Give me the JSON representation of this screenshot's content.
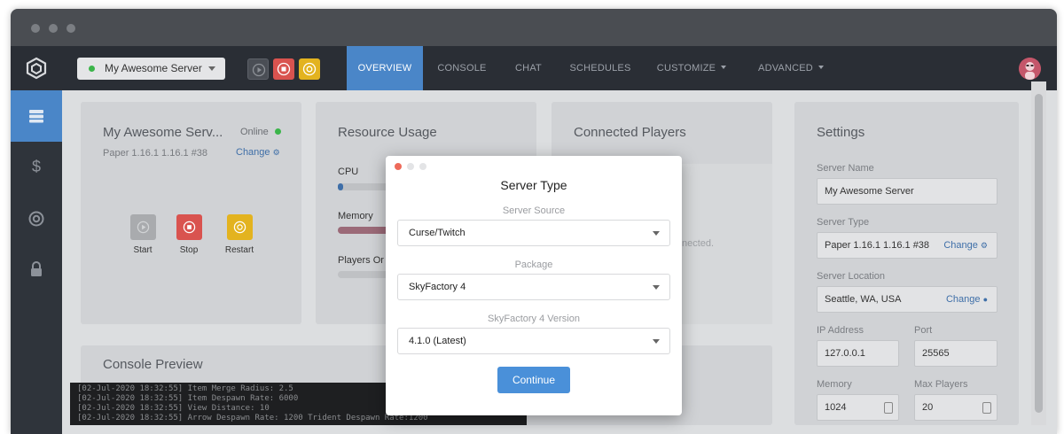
{
  "colors": {
    "accent": "#4a86c8",
    "online": "#3bb54a",
    "stop": "#d9534f",
    "restart": "#e3b31f",
    "continue": "#4a90d9"
  },
  "navbar": {
    "server_name": "My Awesome Server",
    "tabs": [
      {
        "label": "OVERVIEW"
      },
      {
        "label": "CONSOLE"
      },
      {
        "label": "CHAT"
      },
      {
        "label": "SCHEDULES"
      },
      {
        "label": "CUSTOMIZE"
      },
      {
        "label": "ADVANCED"
      }
    ]
  },
  "sidebar": {
    "icons": [
      "servers-icon",
      "dollar-icon",
      "support-icon",
      "lock-icon"
    ]
  },
  "server_card": {
    "title": "My Awesome Serv...",
    "status": "Online",
    "version": "Paper 1.16.1 1.16.1 #38",
    "change": "Change",
    "start": "Start",
    "stop": "Stop",
    "restart": "Restart"
  },
  "resource_card": {
    "title": "Resource Usage",
    "cpu": "CPU",
    "memory": "Memory",
    "players": "Players Or",
    "cpu_level": 0.03,
    "memory_level": 0.9
  },
  "players_card": {
    "title": "Connected Players",
    "empty_text": "nected."
  },
  "settings_card": {
    "title": "Settings",
    "server_name_label": "Server Name",
    "server_name_value": "My Awesome Server",
    "server_type_label": "Server Type",
    "server_type_value": "Paper 1.16.1 1.16.1 #38",
    "server_location_label": "Server Location",
    "server_location_value": "Seattle, WA, USA",
    "change": "Change",
    "ip_label": "IP Address",
    "ip_value": "127.0.0.1",
    "port_label": "Port",
    "port_value": "25565",
    "memory_label": "Memory",
    "memory_value": "1024",
    "max_players_label": "Max Players",
    "max_players_value": "20"
  },
  "console_card": {
    "title": "Console Preview",
    "lines": "[02-Jul-2020 18:32:55] Item Merge Radius: 2.5\n[02-Jul-2020 18:32:55] Item Despawn Rate: 6000\n[02-Jul-2020 18:32:55] View Distance: 10\n[02-Jul-2020 18:32:55] Arrow Despawn Rate: 1200 Trident Despawn Rate:1200"
  },
  "modal": {
    "title": "Server Type",
    "source_label": "Server Source",
    "source_value": "Curse/Twitch",
    "package_label": "Package",
    "package_value": "SkyFactory 4",
    "version_label": "SkyFactory 4 Version",
    "version_value": "4.1.0 (Latest)",
    "continue": "Continue"
  }
}
